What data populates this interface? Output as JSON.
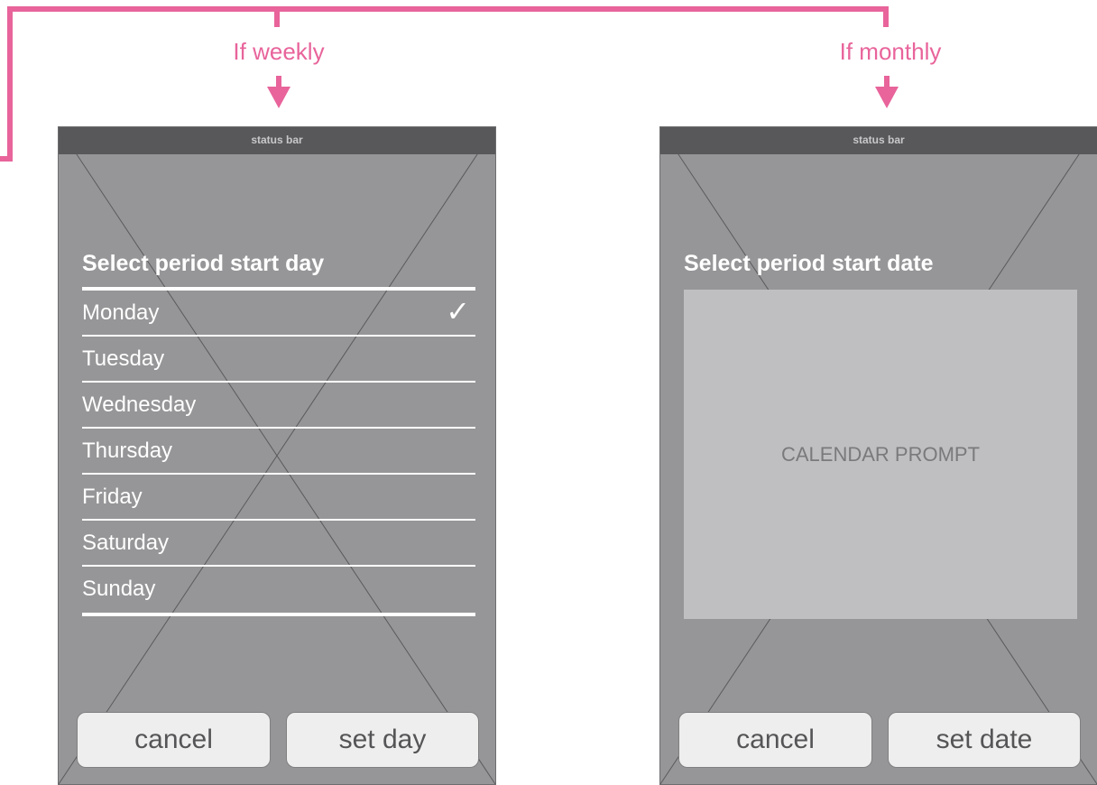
{
  "branches": {
    "weekly_label": "If weekly",
    "monthly_label": "If monthly"
  },
  "colors": {
    "connector": "#e8649b",
    "screen_bg": "#969698",
    "status_bar": "#58585a",
    "calendar_bg": "#bfbfc1",
    "button_bg": "#eeeeee"
  },
  "weekly_screen": {
    "status_bar": "status bar",
    "title": "Select period start day",
    "days": [
      {
        "label": "Monday",
        "selected": true
      },
      {
        "label": "Tuesday",
        "selected": false
      },
      {
        "label": "Wednesday",
        "selected": false
      },
      {
        "label": "Thursday",
        "selected": false
      },
      {
        "label": "Friday",
        "selected": false
      },
      {
        "label": "Saturday",
        "selected": false
      },
      {
        "label": "Sunday",
        "selected": false
      }
    ],
    "check_glyph": "✓",
    "cancel_label": "cancel",
    "confirm_label": "set day"
  },
  "monthly_screen": {
    "status_bar": "status bar",
    "title": "Select period start date",
    "calendar_label": "CALENDAR PROMPT",
    "cancel_label": "cancel",
    "confirm_label": "set date"
  }
}
